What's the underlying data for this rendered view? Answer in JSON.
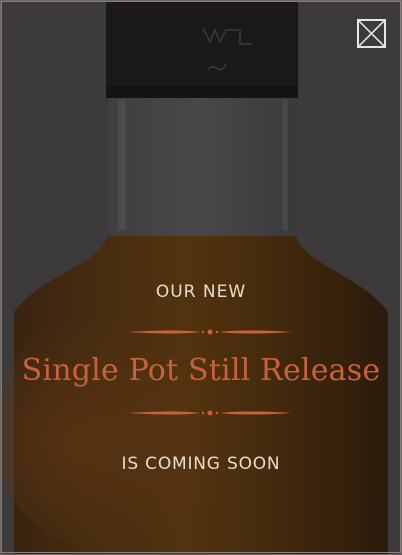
{
  "popup": {
    "eyebrow": "OUR NEW",
    "headline": "Single Pot Still Release",
    "subline": "IS COMING SOON"
  },
  "close_button": {
    "icon": "close-icon"
  },
  "colors": {
    "headline": "#c9613a",
    "text": "#e7dccd",
    "ornament": "#c9613a",
    "overlay": "#3c3a3b",
    "liquid": "#4a2e10"
  }
}
